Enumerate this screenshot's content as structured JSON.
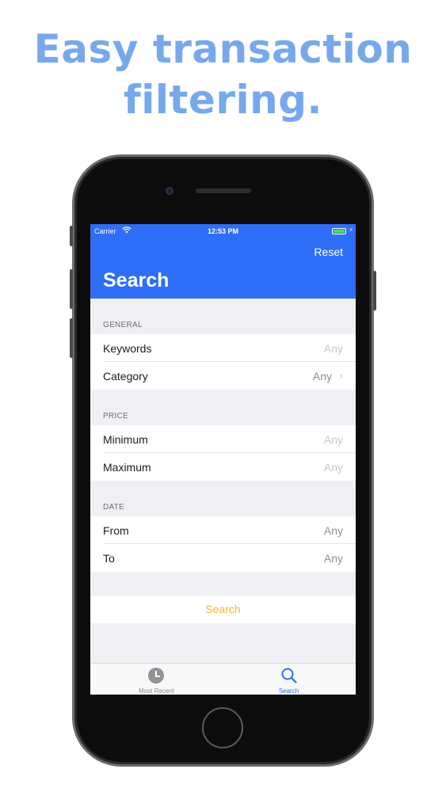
{
  "headline": {
    "line1": "Easy transaction",
    "line2": "filtering."
  },
  "colors": {
    "headline": "#77a8ec",
    "nav_bar": "#2f6ef6",
    "search_accent": "#f4b53d",
    "tab_active": "#2f6ef6"
  },
  "status_bar": {
    "carrier": "Carrier",
    "time": "12:53 PM",
    "battery_level": 1.0
  },
  "nav": {
    "reset_label": "Reset",
    "title": "Search"
  },
  "sections": {
    "general": {
      "header": "GENERAL",
      "keywords": {
        "label": "Keywords",
        "value": "Any"
      },
      "category": {
        "label": "Category",
        "value": "Any"
      }
    },
    "price": {
      "header": "PRICE",
      "minimum": {
        "label": "Minimum",
        "value": "Any"
      },
      "maximum": {
        "label": "Maximum",
        "value": "Any"
      }
    },
    "date": {
      "header": "DATE",
      "from": {
        "label": "From",
        "value": "Any"
      },
      "to": {
        "label": "To",
        "value": "Any"
      }
    }
  },
  "search_button": {
    "label": "Search"
  },
  "tabs": {
    "most_recent": {
      "label": "Most Recent",
      "icon": "clock-icon"
    },
    "search": {
      "label": "Search",
      "icon": "magnifier-icon"
    }
  }
}
